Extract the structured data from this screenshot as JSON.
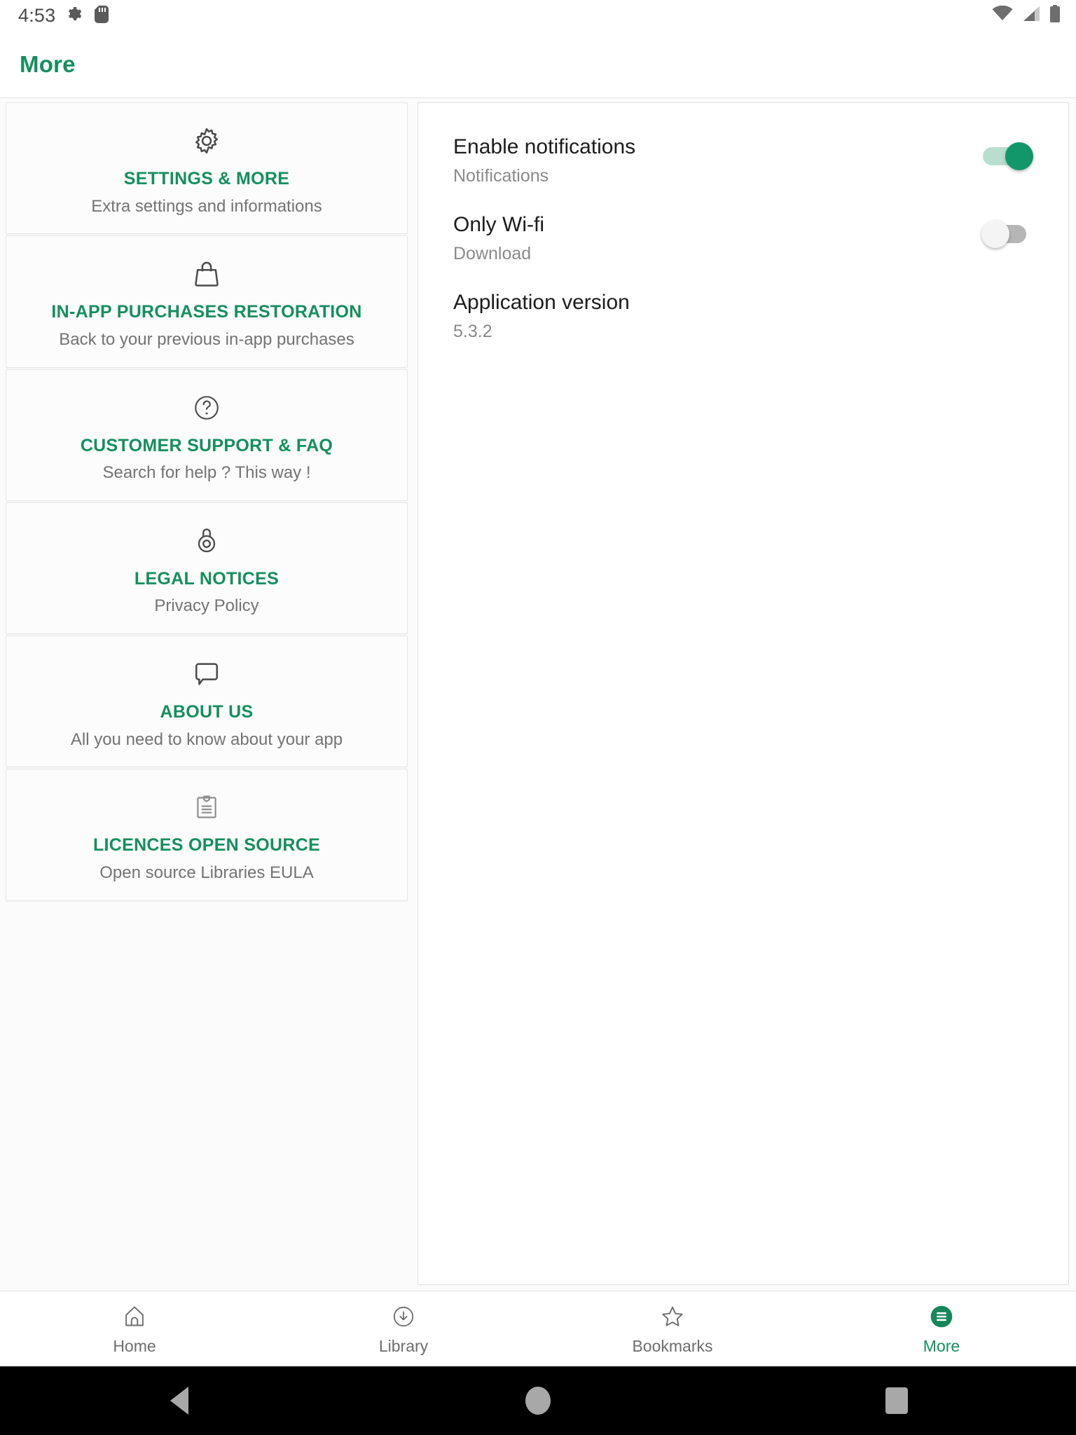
{
  "statusbar": {
    "time": "4:53",
    "left_icons": [
      "gear-icon",
      "sd-card-icon"
    ],
    "right_icons": [
      "wifi-icon",
      "cellular-signal-icon",
      "battery-icon"
    ]
  },
  "appbar": {
    "title": "More"
  },
  "left_pane": {
    "cards": [
      {
        "icon": "gear-icon",
        "title": "SETTINGS & MORE",
        "subtitle": "Extra settings and informations"
      },
      {
        "icon": "handbag-icon",
        "title": "IN-APP PURCHASES RESTORATION",
        "subtitle": "Back to your previous in-app purchases"
      },
      {
        "icon": "question-circle-icon",
        "title": "CUSTOMER SUPPORT & FAQ",
        "subtitle": "Search for help ? This way !"
      },
      {
        "icon": "padlock-icon",
        "title": "LEGAL NOTICES",
        "subtitle": "Privacy Policy"
      },
      {
        "icon": "speech-bubble-icon",
        "title": "ABOUT US",
        "subtitle": "All you need to know about your app"
      },
      {
        "icon": "clipboard-icon",
        "title": "LICENCES OPEN SOURCE",
        "subtitle": "Open source Libraries EULA"
      }
    ]
  },
  "right_pane": {
    "settings": [
      {
        "title": "Enable notifications",
        "subtitle": "Notifications",
        "control": "toggle",
        "value": "on"
      },
      {
        "title": "Only Wi-fi",
        "subtitle": "Download",
        "control": "toggle",
        "value": "off"
      },
      {
        "title": "Application version",
        "subtitle": "5.3.2",
        "control": "none",
        "value": ""
      }
    ]
  },
  "bottom_nav": {
    "items": [
      {
        "label": "Home",
        "icon": "home-icon",
        "active": false
      },
      {
        "label": "Library",
        "icon": "download-circle-icon",
        "active": false
      },
      {
        "label": "Bookmarks",
        "icon": "star-icon",
        "active": false
      },
      {
        "label": "More",
        "icon": "hamburger-circle-icon",
        "active": true
      }
    ]
  },
  "android_nav": {
    "buttons": [
      "back-button",
      "home-button",
      "recents-button"
    ]
  },
  "colors": {
    "accent_green": "#148f5e",
    "toggle_on": "#11976a",
    "text_primary": "#1c1c1c",
    "text_secondary": "#8a8a8a"
  }
}
